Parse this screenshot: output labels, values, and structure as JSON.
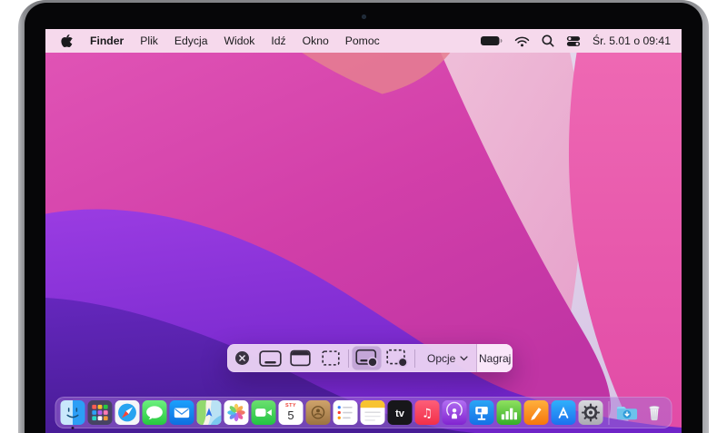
{
  "device": {
    "type": "MacBook display"
  },
  "menu_bar": {
    "items": [
      "Finder",
      "Plik",
      "Edycja",
      "Widok",
      "Idź",
      "Okno",
      "Pomoc"
    ],
    "active_item": "Finder",
    "status_icons": [
      "battery",
      "wifi",
      "spotlight-search",
      "control-center"
    ],
    "clock": "Śr. 5.01 o 09:41"
  },
  "screenshot_toolbar": {
    "buttons": [
      {
        "id": "close"
      },
      {
        "id": "capture-entire-screen"
      },
      {
        "id": "capture-window"
      },
      {
        "id": "capture-selection"
      },
      {
        "id": "record-entire-screen",
        "selected": true
      },
      {
        "id": "record-selection"
      }
    ],
    "options_label": "Opcje",
    "record_label": "Nagraj"
  },
  "dock": {
    "apps": [
      "Finder",
      "Launchpad",
      "Safari",
      "Messages",
      "Mail",
      "Maps",
      "Photos",
      "FaceTime",
      "Calendar",
      "Contacts",
      "Reminders",
      "Notes",
      "TV",
      "Music",
      "Podcasts",
      "Keynote",
      "Numbers",
      "Pages",
      "App Store",
      "System Preferences"
    ],
    "tray": [
      "Downloads",
      "Trash"
    ],
    "running_apps": [
      "Finder"
    ],
    "calendar_badge": {
      "month": "STY",
      "day": "5"
    }
  },
  "wallpaper": {
    "name": "macOS Monterey abstract waves",
    "palette": [
      "#e9dff0",
      "#f0a9c4",
      "#ec5fae",
      "#d445a9",
      "#e57f90",
      "#8d35dc",
      "#5a28ae",
      "#461d92"
    ]
  }
}
